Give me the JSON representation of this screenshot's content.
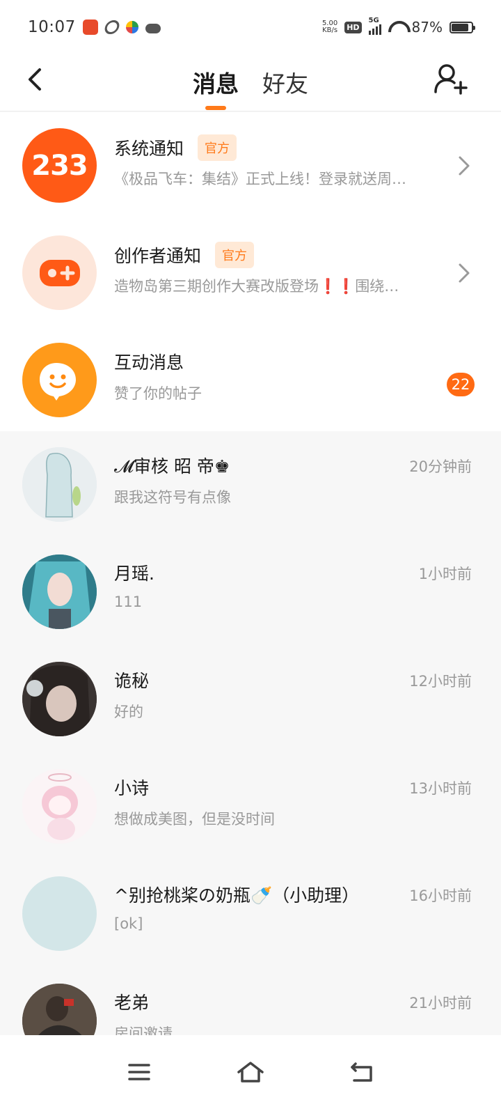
{
  "status_bar": {
    "time": "10:07",
    "speed_value": "5.00",
    "speed_unit": "KB/s",
    "hd": "HD",
    "network": "5G",
    "battery_percent": "87%",
    "battery_level": 0.87
  },
  "header": {
    "tabs": [
      {
        "label": "消息",
        "active": true
      },
      {
        "label": "好友",
        "active": false
      }
    ]
  },
  "system_items": [
    {
      "title": "系统通知",
      "badge": "官方",
      "preview": "《极品飞车：集结》正式上线！登录就送周…",
      "avatar_text": "233",
      "avatar_color": "#ff5a16"
    },
    {
      "title": "创作者通知",
      "badge": "官方",
      "preview": "造物岛第三期创作大赛改版登场❗❗围绕…",
      "avatar_color": "#fde6da"
    },
    {
      "title": "互动消息",
      "preview": "赞了你的帖子",
      "count": "22",
      "avatar_color": "#ff9a1a"
    }
  ],
  "chats": [
    {
      "name": "𝓜审核 昭  帝♚",
      "message": "跟我这符号有点像",
      "time": "20分钟前",
      "avatar_color": "#dfe8ea"
    },
    {
      "name": "月瑶.",
      "message": "111",
      "time": "1小时前",
      "avatar_color": "#3f8a96"
    },
    {
      "name": "诡秘",
      "message": "好的",
      "time": "12小时前",
      "avatar_color": "#6a5e58"
    },
    {
      "name": "小诗",
      "message": "想做成美图，但是没时间",
      "time": "13小时前",
      "avatar_color": "#fbeef2"
    },
    {
      "name": "^别抢桃桨の奶瓶🍼（小助理）",
      "message": "[ok]",
      "time": "16小时前",
      "avatar_color": "#d3e6e8"
    },
    {
      "name": "老弟",
      "message": "房间邀请",
      "time": "21小时前",
      "avatar_color": "#4a4038"
    }
  ],
  "colors": {
    "accent": "#ff7a1a",
    "badge_bg": "#ffe9d6",
    "count_badge": "#ff6a13"
  }
}
